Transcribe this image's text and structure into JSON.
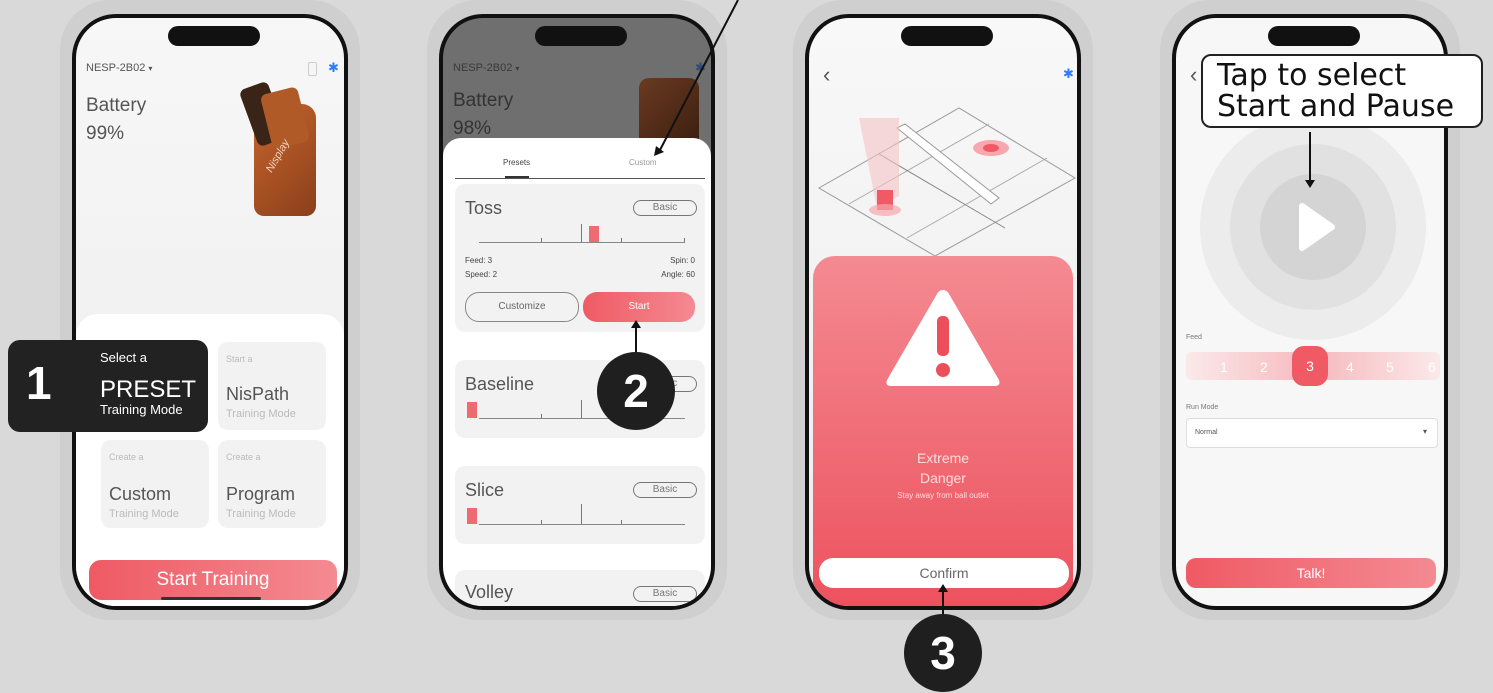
{
  "phone1": {
    "device_name": "NESP-2B02",
    "device_caret": "▾",
    "battery_label": "Battery",
    "battery_value": "99%",
    "product_logo": "Nisplay",
    "callout_step": "1",
    "callout_prefix": "Select a",
    "callout_title": "PRESET",
    "callout_sub": "Training Mode",
    "tiles": [
      {
        "prefix": "Start a",
        "title": "NisPath",
        "sub": "Training Mode"
      },
      {
        "prefix": "Create a",
        "title": "Custom",
        "sub": "Training Mode"
      },
      {
        "prefix": "Create a",
        "title": "Program",
        "sub": "Training Mode"
      }
    ],
    "start_button": "Start Training"
  },
  "phone2": {
    "device_name": "NESP-2B02",
    "device_caret": "▾",
    "battery_label": "Battery",
    "battery_value": "98%",
    "tabs": [
      "Presets",
      "Custom"
    ],
    "presets": [
      {
        "name": "Toss",
        "badge": "Basic",
        "feed": "Feed: 3",
        "spin": "Spin: 0",
        "speed": "Speed: 2",
        "angle": "Angle: 60",
        "customize": "Customize",
        "start": "Start"
      },
      {
        "name": "Baseline",
        "badge": "Basic"
      },
      {
        "name": "Slice",
        "badge": "Basic"
      },
      {
        "name": "Volley",
        "badge": "Basic"
      }
    ],
    "callout_step": "2"
  },
  "phone3": {
    "back": "‹",
    "warning_title_1": "Extreme",
    "warning_title_2": "Danger",
    "warning_sub": "Stay away from ball outlet",
    "confirm": "Confirm",
    "callout_step": "3"
  },
  "phone4": {
    "back": "‹",
    "tooltip_line1": "Tap to select",
    "tooltip_line2": "Start and Pause",
    "feed_label": "Feed",
    "feed_options": [
      "1",
      "2",
      "3",
      "4",
      "5",
      "6"
    ],
    "feed_selected": "3",
    "run_mode_label": "Run Mode",
    "run_mode_value": "Normal",
    "talk_button": "Talk!"
  },
  "colors": {
    "accent": "#ef5a64",
    "accent_light": "#f48a92",
    "dark": "#1f1f1f"
  },
  "icons": [
    "bluetooth-icon",
    "battery-icon",
    "back-icon",
    "play-icon",
    "warning-icon",
    "chevron-down-icon"
  ]
}
